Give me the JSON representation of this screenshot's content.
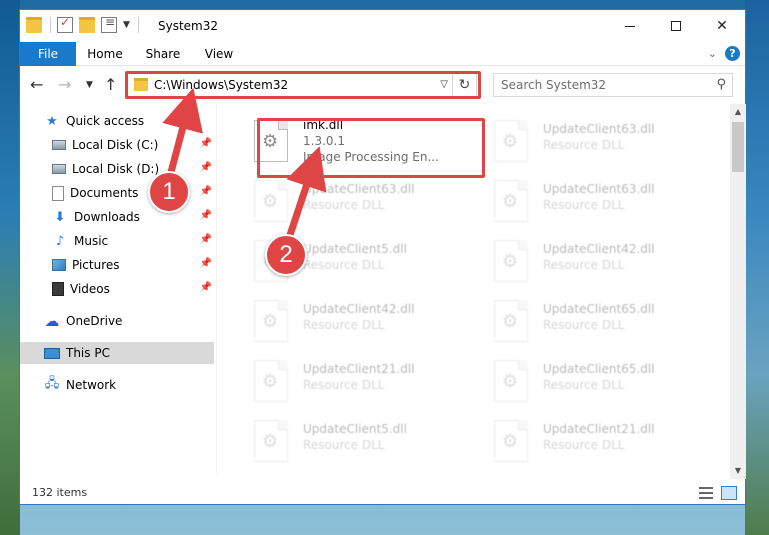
{
  "window": {
    "title": "System32",
    "controls": {
      "minimize": "",
      "maximize": "",
      "close": "✕"
    }
  },
  "ribbon": {
    "tabs": [
      {
        "label": "File"
      },
      {
        "label": "Home"
      },
      {
        "label": "Share"
      },
      {
        "label": "View"
      }
    ],
    "help": "?"
  },
  "address": {
    "path": "C:\\Windows\\System32",
    "search_placeholder": "Search System32"
  },
  "nav": {
    "quick_access": "Quick access",
    "items": [
      {
        "label": "Local Disk (C:)",
        "pinned": true
      },
      {
        "label": "Local Disk (D:)",
        "pinned": true
      },
      {
        "label": "Documents",
        "pinned": true
      },
      {
        "label": "Downloads",
        "pinned": true
      },
      {
        "label": "Music",
        "pinned": true
      },
      {
        "label": "Pictures",
        "pinned": true
      },
      {
        "label": "Videos",
        "pinned": true
      }
    ],
    "onedrive": "OneDrive",
    "this_pc": "This PC",
    "network": "Network"
  },
  "files": [
    {
      "name": "imk.dll",
      "version": "1.3.0.1",
      "description": "Image Processing En..."
    },
    {
      "name": "UpdateClient63.dll",
      "description": "Resource DLL"
    },
    {
      "name": "UpdateClient63.dll",
      "description": "Resource DLL"
    },
    {
      "name": "UpdateClient63.dll",
      "description": "Resource DLL"
    },
    {
      "name": "UpdateClient5.dll",
      "description": "Resource DLL"
    },
    {
      "name": "UpdateClient42.dll",
      "description": "Resource DLL"
    },
    {
      "name": "UpdateClient42.dll",
      "description": "Resource DLL"
    },
    {
      "name": "UpdateClient65.dll",
      "description": "Resource DLL"
    },
    {
      "name": "UpdateClient21.dll",
      "description": "Resource DLL"
    },
    {
      "name": "UpdateClient65.dll",
      "description": "Resource DLL"
    },
    {
      "name": "UpdateClient5.dll",
      "description": "Resource DLL"
    },
    {
      "name": "UpdateClient21.dll",
      "description": "Resource DLL"
    }
  ],
  "status": {
    "item_count": "132 items"
  },
  "annotations": {
    "step1": "1",
    "step2": "2",
    "color": "#e04545"
  }
}
